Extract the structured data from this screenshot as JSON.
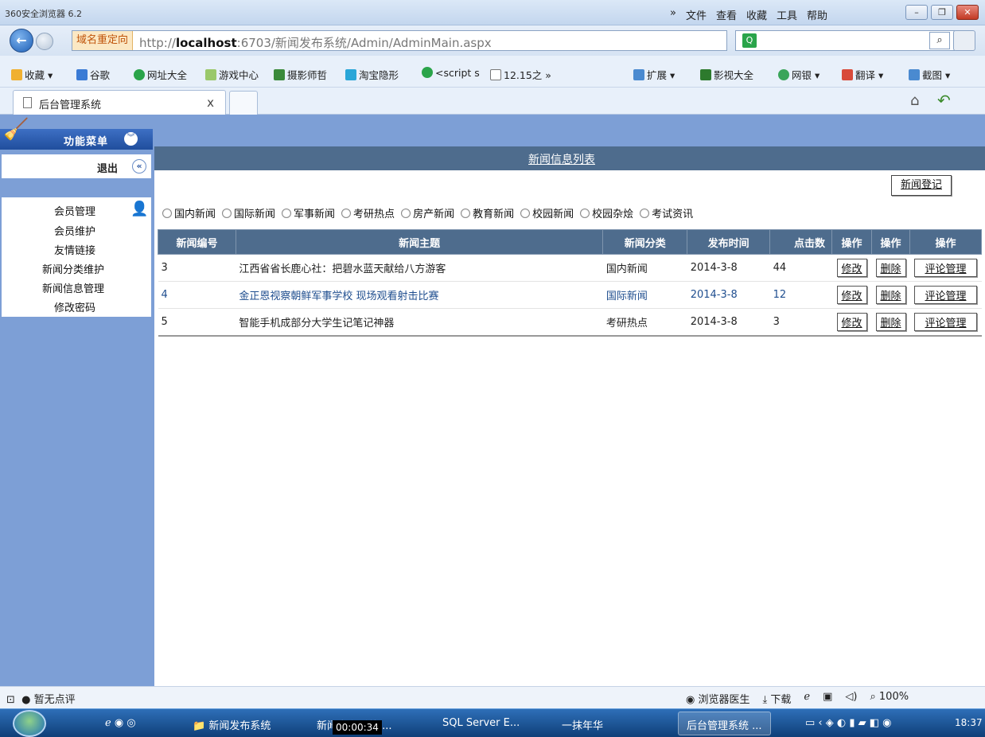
{
  "browser": {
    "title": "360安全浏览器 6.2",
    "menus": [
      "»",
      "文件",
      "查看",
      "收藏",
      "工具",
      "帮助"
    ],
    "redirect_tag": "域名重定向",
    "url_prefix": "http://",
    "url_host": "localhost",
    "url_rest": ":6703/新闻发布系统/Admin/AdminMain.aspx",
    "bookmarks": [
      "收藏",
      "谷歌",
      "网址大全",
      "游戏中心",
      "摄影师哲",
      "淘宝隐形",
      "<script s",
      "12.15之 »",
      "扩展",
      "影视大全",
      "网银",
      "翻译",
      "截图"
    ],
    "tab_label": "后台管理系统",
    "tab_close": "x"
  },
  "sidebar": {
    "menu_title": "功能菜单",
    "logout_label": "退出",
    "section_head": "会员管理",
    "items": [
      "会员维护",
      "友情链接",
      "新闻分类维护",
      "新闻信息管理",
      "修改密码"
    ]
  },
  "main": {
    "list_title": "新闻信息列表",
    "register_label": "新闻登记",
    "categories": [
      "国内新闻",
      "国际新闻",
      "军事新闻",
      "考研热点",
      "房产新闻",
      "教育新闻",
      "校园新闻",
      "校园杂烩",
      "考试资讯"
    ],
    "columns": [
      "新闻编号",
      "新闻主题",
      "新闻分类",
      "发布时间",
      "点击数",
      "操作",
      "操作",
      "操作"
    ],
    "rows": [
      {
        "id": "3",
        "title": "江西省省长鹿心社：把碧水蓝天献给八方游客",
        "category": "国内新闻",
        "date": "2014-3-8",
        "clicks": "44",
        "edit": "修改",
        "delete": "删除",
        "comments": "评论管理"
      },
      {
        "id": "4",
        "title": "金正恩视察朝鲜军事学校 现场观看射击比赛",
        "category": "国际新闻",
        "date": "2014-3-8",
        "clicks": "12",
        "edit": "修改",
        "delete": "删除",
        "comments": "评论管理"
      },
      {
        "id": "5",
        "title": "智能手机成部分大学生记笔记神器",
        "category": "考研热点",
        "date": "2014-3-8",
        "clicks": "3",
        "edit": "修改",
        "delete": "删除",
        "comments": "评论管理"
      }
    ]
  },
  "statusbar": {
    "left": "暂无点评",
    "items": [
      "浏览器医生",
      "下载",
      "100%"
    ]
  },
  "taskbar": {
    "items": [
      "新闻发布系统",
      "新闻发布系统 ...",
      "SQL Server E...",
      "一抹年华",
      "后台管理系统 ..."
    ],
    "timer": "00:00:34",
    "clock": "18:37"
  }
}
